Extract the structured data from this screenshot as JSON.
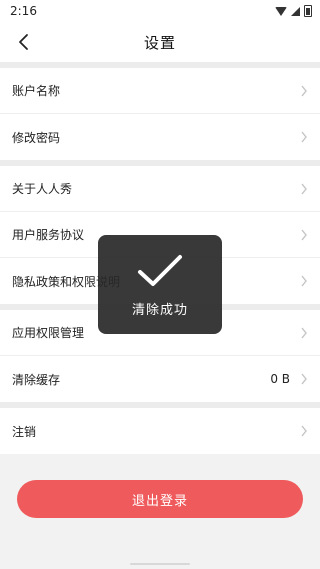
{
  "status_bar": {
    "time": "2:16"
  },
  "header": {
    "title": "设置"
  },
  "sections": [
    [
      {
        "label": "账户名称"
      },
      {
        "label": "修改密码"
      }
    ],
    [
      {
        "label": "关于人人秀"
      },
      {
        "label": "用户服务协议"
      },
      {
        "label": "隐私政策和权限说明"
      }
    ],
    [
      {
        "label": "应用权限管理"
      },
      {
        "label": "清除缓存",
        "value": "0 B"
      }
    ],
    [
      {
        "label": "注销"
      }
    ]
  ],
  "logout": {
    "label": "退出登录"
  },
  "toast": {
    "message": "清除成功"
  },
  "colors": {
    "accent": "#ef5a5c",
    "toast_bg": "#282828"
  }
}
